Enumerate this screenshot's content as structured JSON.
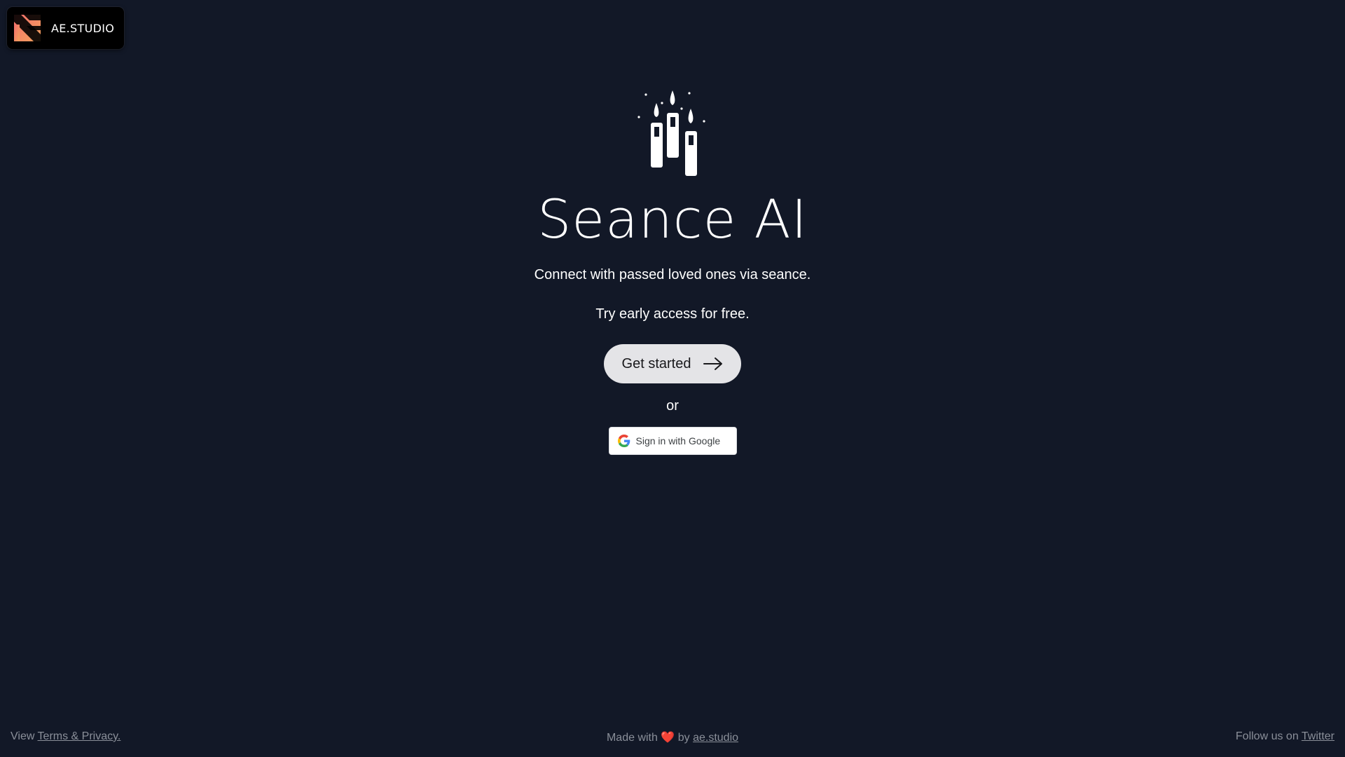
{
  "brand": {
    "name": "AE.STUDIO",
    "logo_icon": "ae-studio-logo-icon",
    "logo_colors": [
      "#f97a52",
      "#f2a25c",
      "#f26d6d"
    ]
  },
  "hero": {
    "icon": "candles-icon",
    "title": "Seance AI",
    "subtitle": "Connect with passed loved ones via seance.",
    "early_access": "Try early access for free.",
    "get_started_label": "Get started",
    "get_started_icon": "arrow-right-icon",
    "or_text": "or",
    "google_signin_label": "Sign in with Google",
    "google_icon": "google-icon"
  },
  "footer": {
    "left_prefix": "View",
    "terms_link": "Terms & Privacy.",
    "center_prefix": "Made with",
    "heart": "❤️",
    "center_by": "by",
    "studio_link": "ae.studio",
    "right_prefix": "Follow us on",
    "twitter_link": "Twitter"
  },
  "colors": {
    "background": "#121827",
    "button_bg": "#e4e4e7",
    "heart": "#e11d2e",
    "footer_text": "#8a8f99"
  }
}
